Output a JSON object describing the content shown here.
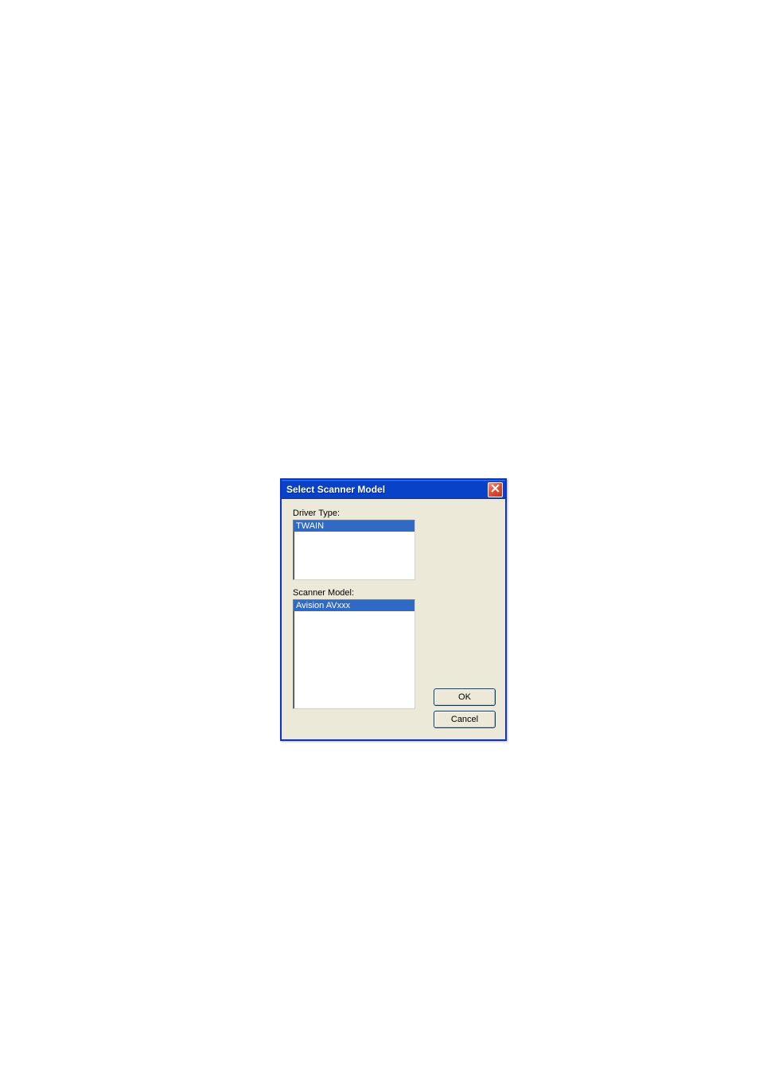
{
  "dialog": {
    "title": "Select Scanner Model",
    "driver_type_label": "Driver Type:",
    "scanner_model_label": "Scanner Model:",
    "driver_items": [
      "TWAIN"
    ],
    "model_items": [
      "Avision AVxxx"
    ],
    "ok_label": "OK",
    "cancel_label": "Cancel"
  }
}
